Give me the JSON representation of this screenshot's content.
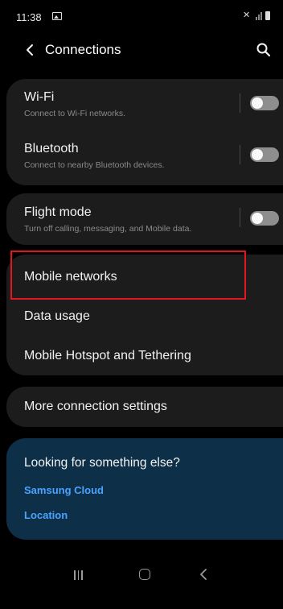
{
  "status_bar": {
    "time": "11:38",
    "icons": [
      "gallery-icon",
      "mute-icon",
      "signal-icon",
      "battery-icon"
    ]
  },
  "header": {
    "title": "Connections",
    "back_icon": "chevron-left-icon",
    "search_icon": "search-icon"
  },
  "groups": {
    "wireless": {
      "wifi": {
        "title": "Wi-Fi",
        "subtitle": "Connect to Wi-Fi networks.",
        "enabled": false
      },
      "bluetooth": {
        "title": "Bluetooth",
        "subtitle": "Connect to nearby Bluetooth devices.",
        "enabled": false
      }
    },
    "flight": {
      "flight_mode": {
        "title": "Flight mode",
        "subtitle": "Turn off calling, messaging, and Mobile data.",
        "enabled": false
      }
    },
    "network": {
      "mobile_networks": {
        "title": "Mobile networks",
        "highlighted": true
      },
      "data_usage": {
        "title": "Data usage"
      },
      "hotspot": {
        "title": "Mobile Hotspot and Tethering"
      }
    },
    "more": {
      "more_settings": {
        "title": "More connection settings"
      }
    }
  },
  "suggestions": {
    "title": "Looking for something else?",
    "links": [
      "Samsung Cloud",
      "Location"
    ]
  },
  "colors": {
    "background": "#000000",
    "card": "#1c1c1c",
    "suggestion_card": "#0d2f47",
    "link": "#4aa3ff",
    "highlight": "#e3161f",
    "toggle_off": "#8e8e8e"
  },
  "nav_bar": {
    "icons": [
      "recents-icon",
      "home-icon",
      "back-icon"
    ]
  }
}
